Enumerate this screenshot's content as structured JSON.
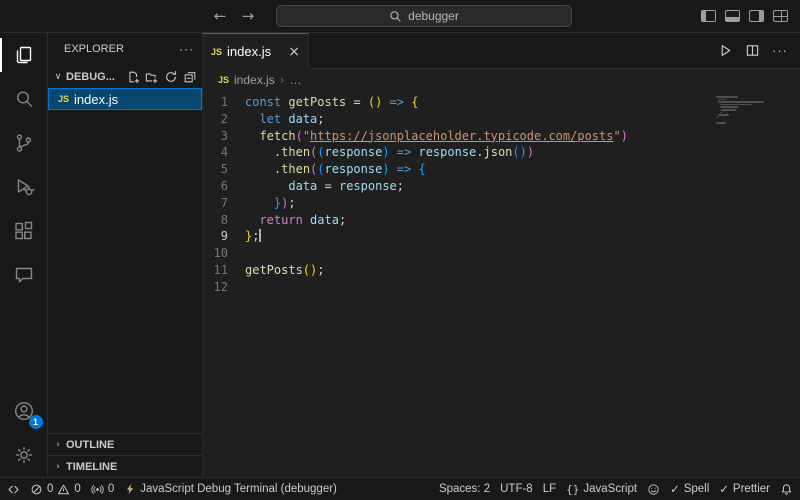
{
  "colors": {
    "accent": "#0078d4",
    "selection_background": "#094771",
    "js_badge": "#e8d44d",
    "chrome_background": "#181818",
    "editor_background": "#1f1f1f",
    "syntax": {
      "keyword": "#569cd6",
      "control": "#c586c0",
      "function": "#dcdcaa",
      "variable": "#9cdcfe",
      "string": "#ce9178",
      "bracket1": "#ffd700",
      "bracket2": "#da70d6",
      "bracket3": "#179fff"
    }
  },
  "title_bar": {
    "back": "←",
    "forward": "→",
    "search_text": "debugger"
  },
  "activity_bar": {
    "account_badge": "1"
  },
  "sidebar": {
    "title": "EXPLORER",
    "more": "···",
    "section": {
      "chevron": "∨",
      "label": "DEBUG..."
    },
    "file": {
      "badge": "JS",
      "name": "index.js"
    },
    "outline": {
      "chevron": "›",
      "label": "OUTLINE"
    },
    "timeline": {
      "chevron": "›",
      "label": "TIMELINE"
    }
  },
  "editor": {
    "tab": {
      "badge": "JS",
      "label": "index.js",
      "close": "×"
    },
    "actions": {
      "more": "···"
    },
    "breadcrumb": {
      "badge": "JS",
      "file": "index.js",
      "sep": "›",
      "more": "…"
    },
    "code": {
      "active_line": 9,
      "lines": [
        {
          "n": 1,
          "tokens": [
            [
              "const",
              "kw"
            ],
            [
              " ",
              "pl"
            ],
            [
              "getPosts",
              "fn"
            ],
            [
              " ",
              "pl"
            ],
            [
              "=",
              "op"
            ],
            [
              " ",
              "pl"
            ],
            [
              "(",
              "b1"
            ],
            [
              ")",
              "b1"
            ],
            [
              " ",
              "pl"
            ],
            [
              "=>",
              "kw"
            ],
            [
              " ",
              "pl"
            ],
            [
              "{",
              "b1"
            ]
          ]
        },
        {
          "n": 2,
          "tokens": [
            [
              "  ",
              "pl"
            ],
            [
              "let",
              "kw"
            ],
            [
              " ",
              "pl"
            ],
            [
              "data",
              "vr"
            ],
            [
              ";",
              "op"
            ]
          ]
        },
        {
          "n": 3,
          "tokens": [
            [
              "  ",
              "pl"
            ],
            [
              "fetch",
              "fn"
            ],
            [
              "(",
              "b2"
            ],
            [
              "\"",
              "str"
            ],
            [
              "https://jsonplaceholder.typicode.com/posts",
              "lnk"
            ],
            [
              "\"",
              "str"
            ],
            [
              ")",
              "b2"
            ]
          ]
        },
        {
          "n": 4,
          "tokens": [
            [
              "    ",
              "pl"
            ],
            [
              ".",
              "op"
            ],
            [
              "then",
              "fn"
            ],
            [
              "(",
              "b2"
            ],
            [
              "(",
              "b3"
            ],
            [
              "response",
              "vr"
            ],
            [
              ")",
              "b3"
            ],
            [
              " ",
              "pl"
            ],
            [
              "=>",
              "kw"
            ],
            [
              " ",
              "pl"
            ],
            [
              "response",
              "vr"
            ],
            [
              ".",
              "op"
            ],
            [
              "json",
              "fn"
            ],
            [
              "(",
              "b3"
            ],
            [
              ")",
              "b3"
            ],
            [
              ")",
              "b2"
            ]
          ]
        },
        {
          "n": 5,
          "tokens": [
            [
              "    ",
              "pl"
            ],
            [
              ".",
              "op"
            ],
            [
              "then",
              "fn"
            ],
            [
              "(",
              "b2"
            ],
            [
              "(",
              "b3"
            ],
            [
              "response",
              "vr"
            ],
            [
              ")",
              "b3"
            ],
            [
              " ",
              "pl"
            ],
            [
              "=>",
              "kw"
            ],
            [
              " ",
              "pl"
            ],
            [
              "{",
              "b3"
            ]
          ]
        },
        {
          "n": 6,
          "tokens": [
            [
              "      ",
              "pl"
            ],
            [
              "data",
              "vr"
            ],
            [
              " ",
              "pl"
            ],
            [
              "=",
              "op"
            ],
            [
              " ",
              "pl"
            ],
            [
              "response",
              "vr"
            ],
            [
              ";",
              "op"
            ]
          ]
        },
        {
          "n": 7,
          "tokens": [
            [
              "    ",
              "pl"
            ],
            [
              "}",
              "b3"
            ],
            [
              ")",
              "b2"
            ],
            [
              ";",
              "op"
            ]
          ]
        },
        {
          "n": 8,
          "tokens": [
            [
              "  ",
              "pl"
            ],
            [
              "return",
              "ctl"
            ],
            [
              " ",
              "pl"
            ],
            [
              "data",
              "vr"
            ],
            [
              ";",
              "op"
            ]
          ]
        },
        {
          "n": 9,
          "tokens": [
            [
              "}",
              "b1"
            ],
            [
              ";",
              "op"
            ]
          ]
        },
        {
          "n": 10,
          "tokens": []
        },
        {
          "n": 11,
          "tokens": [
            [
              "getPosts",
              "fn"
            ],
            [
              "(",
              "b1"
            ],
            [
              ")",
              "b1"
            ],
            [
              ";",
              "op"
            ]
          ]
        },
        {
          "n": 12,
          "tokens": []
        }
      ]
    }
  },
  "status_bar": {
    "errors": "0",
    "warnings": "0",
    "ports": "0",
    "terminal": "JavaScript Debug Terminal (debugger)",
    "spaces": "Spaces: 2",
    "encoding": "UTF-8",
    "eol": "LF",
    "lang_braces": "{}",
    "language": "JavaScript",
    "check": "✓",
    "spell": "Spell",
    "prettier": "Prettier"
  }
}
